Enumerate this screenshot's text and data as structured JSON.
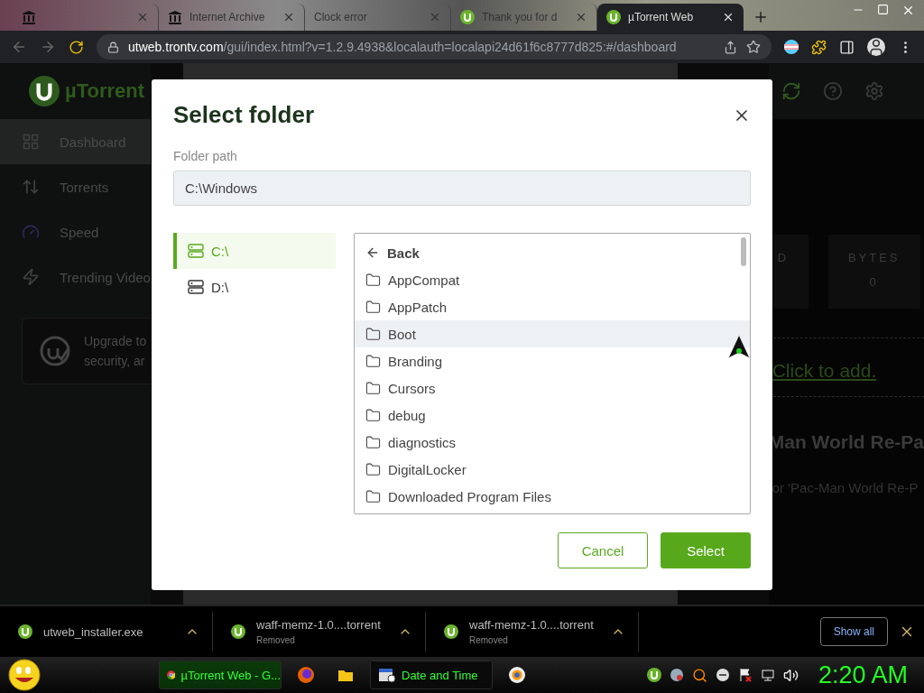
{
  "browser": {
    "tabs": [
      {
        "kind": "archive",
        "selected": false
      },
      {
        "kind": "archive",
        "title": "Internet Archive",
        "selected": false
      },
      {
        "kind": "plain",
        "title": "Clock error",
        "selected": false
      },
      {
        "kind": "utorrent",
        "title": "Thank you for d",
        "selected": false
      },
      {
        "kind": "utorrent",
        "title": "µTorrent Web",
        "selected": true
      }
    ],
    "url": "**utweb.trontv.com**/gui/index.html?v=1.2.9.4938&localauth=localapi24d61f6c8777d825:#/dashboard"
  },
  "app": {
    "logo": "µTorrent",
    "nav": [
      {
        "kind": "dashboard",
        "label": "Dashboard",
        "selected": true
      },
      {
        "kind": "torrents",
        "label": "Torrents",
        "selected": false
      },
      {
        "kind": "speed",
        "label": "Speed",
        "selected": false
      },
      {
        "kind": "videos",
        "label": "Trending Video",
        "selected": false
      }
    ],
    "upgrade": {
      "line_1": "Upgrade to",
      "line_2": "security, ar"
    },
    "stats": [
      {
        "label": "D"
      },
      {
        "label": "BYTES",
        "value": "0"
      }
    ],
    "add_link": "Click to add.",
    "title": "Man World Re-Pa",
    "subtitle": "or 'Pac-Man World Re-P"
  },
  "dialog": {
    "title": "Select folder",
    "path_label": "Folder path",
    "path": "C:\\Windows",
    "drives": [
      {
        "label": "C:\\",
        "selected": true
      },
      {
        "label": "D:\\",
        "selected": false
      }
    ],
    "back": "Back",
    "folders": [
      {
        "name": "AppCompat",
        "hovered": false
      },
      {
        "name": "AppPatch",
        "hovered": false
      },
      {
        "name": "Boot",
        "hovered": true
      },
      {
        "name": "Branding",
        "hovered": false
      },
      {
        "name": "Cursors",
        "hovered": false
      },
      {
        "name": "debug",
        "hovered": false
      },
      {
        "name": "diagnostics",
        "hovered": false
      },
      {
        "name": "DigitalLocker",
        "hovered": false
      },
      {
        "name": "Downloaded Program Files",
        "hovered": false
      }
    ],
    "cancel": "Cancel",
    "select": "Select"
  },
  "downloads": {
    "items": [
      {
        "name": "utweb_installer.exe"
      },
      {
        "name": "waff-memz-1.0....torrent",
        "status": "Removed"
      },
      {
        "name": "waff-memz-1.0....torrent",
        "status": "Removed"
      }
    ],
    "show_all": "Show all"
  },
  "taskbar": {
    "tasks": [
      {
        "kind": "chrome",
        "label": "µTorrent Web - G...",
        "selected": true
      },
      {
        "kind": "firefox",
        "selected": false
      },
      {
        "kind": "folder",
        "selected": false
      },
      {
        "kind": "clock",
        "label": "Date and Time",
        "selected": false
      },
      {
        "kind": "chrome-alt",
        "selected": false
      }
    ],
    "clock": "2:20 AM"
  }
}
